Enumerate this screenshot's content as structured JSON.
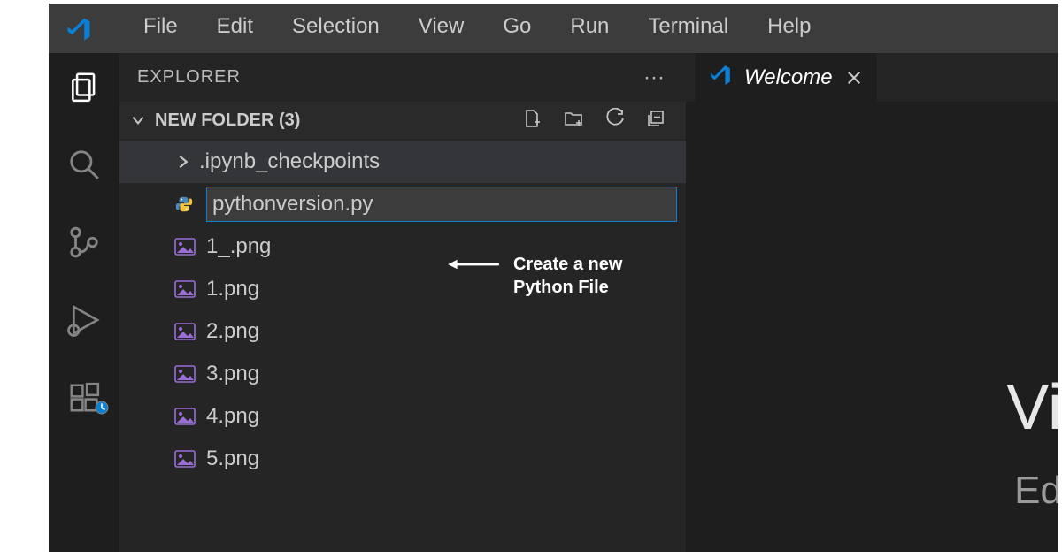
{
  "menu": {
    "items": [
      "File",
      "Edit",
      "Selection",
      "View",
      "Go",
      "Run",
      "Terminal",
      "Help"
    ]
  },
  "activity": {
    "items": [
      {
        "name": "explorer",
        "active": true
      },
      {
        "name": "search",
        "active": false
      },
      {
        "name": "source-control",
        "active": false
      },
      {
        "name": "run-debug",
        "active": false
      },
      {
        "name": "extensions",
        "active": false
      }
    ]
  },
  "explorer": {
    "title": "EXPLORER",
    "section_label": "NEW FOLDER (3)",
    "tree": {
      "folder": ".ipynb_checkpoints",
      "new_file_value": "pythonversion.py",
      "files": [
        "1_.png",
        "1.png",
        "2.png",
        "3.png",
        "4.png",
        "5.png"
      ]
    }
  },
  "editor": {
    "tab_label": "Welcome",
    "welcome_title_fragment": "Vi",
    "welcome_sub_fragment": "Ed"
  },
  "annotation": {
    "text": "Create a new Python File"
  }
}
